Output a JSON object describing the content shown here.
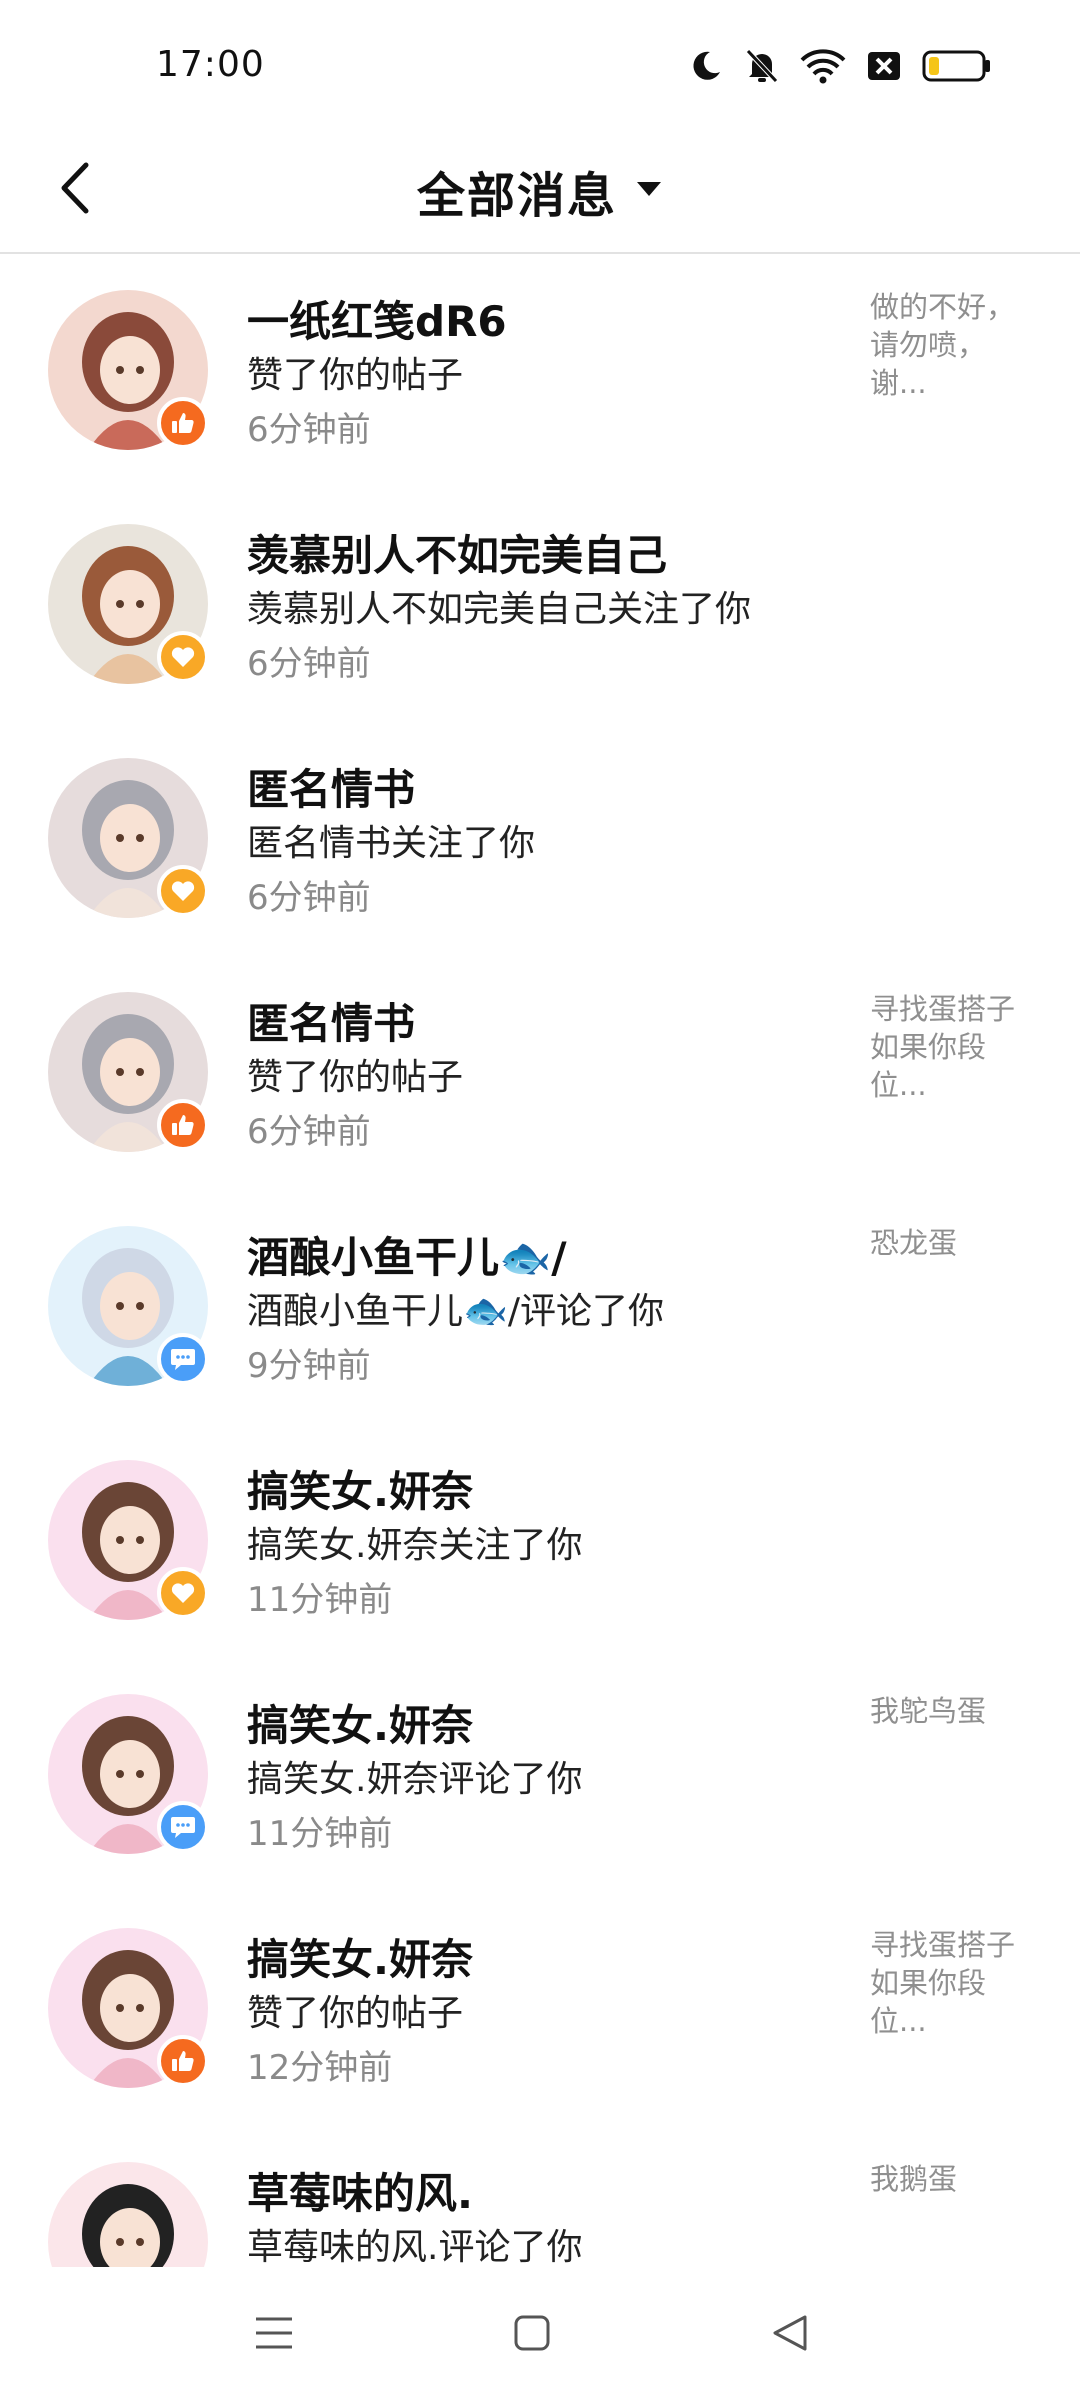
{
  "status_bar": {
    "time": "17:00",
    "icons": [
      "moon-icon",
      "bell-off-icon",
      "wifi-icon",
      "sim-x-icon",
      "battery-icon"
    ],
    "battery_level": 0.2
  },
  "header": {
    "title": "全部消息",
    "back_icon": "chevron-left-icon",
    "dropdown_icon": "triangle-down-icon"
  },
  "colors": {
    "like_badge": "#f56a1f",
    "follow_badge": "#f9a826",
    "comment_badge": "#4a9ef8",
    "time_text": "#8a8a8a",
    "snippet_text": "#8f8f8f",
    "battery_fill": "#f5c518"
  },
  "messages": [
    {
      "name": "一纸红笺dR6",
      "action": "赞了你的帖子",
      "time": "6分钟前",
      "snippet": "做的不好，\n请勿喷，\n谢...",
      "badge": "thumbs-up-icon"
    },
    {
      "name": "羡慕别人不如完美自己",
      "action": "羡慕别人不如完美自己关注了你",
      "time": "6分钟前",
      "snippet": "",
      "badge": "heart-icon"
    },
    {
      "name": "匿名情书",
      "action": "匿名情书关注了你",
      "time": "6分钟前",
      "snippet": "",
      "badge": "heart-icon"
    },
    {
      "name": "匿名情书",
      "action": "赞了你的帖子",
      "time": "6分钟前",
      "snippet": "寻找蛋搭子\n如果你段\n位...",
      "badge": "thumbs-up-icon"
    },
    {
      "name": "酒酿小鱼干儿🐟/",
      "action": "酒酿小鱼干儿🐟/评论了你",
      "time": "9分钟前",
      "snippet": "恐龙蛋",
      "badge": "comment-icon"
    },
    {
      "name": "搞笑女.妍奈",
      "action": "搞笑女.妍奈关注了你",
      "time": "11分钟前",
      "snippet": "",
      "badge": "heart-icon"
    },
    {
      "name": "搞笑女.妍奈",
      "action": "搞笑女.妍奈评论了你",
      "time": "11分钟前",
      "snippet": "我鸵鸟蛋",
      "badge": "comment-icon"
    },
    {
      "name": "搞笑女.妍奈",
      "action": "赞了你的帖子",
      "time": "12分钟前",
      "snippet": "寻找蛋搭子\n如果你段\n位...",
      "badge": "thumbs-up-icon"
    },
    {
      "name": "草莓味的风.",
      "action": "草莓味的风.评论了你",
      "time": "",
      "snippet": "我鹅蛋",
      "badge": ""
    }
  ],
  "nav_bar": {
    "buttons": [
      "menu-icon",
      "home-square-icon",
      "back-triangle-icon"
    ]
  }
}
